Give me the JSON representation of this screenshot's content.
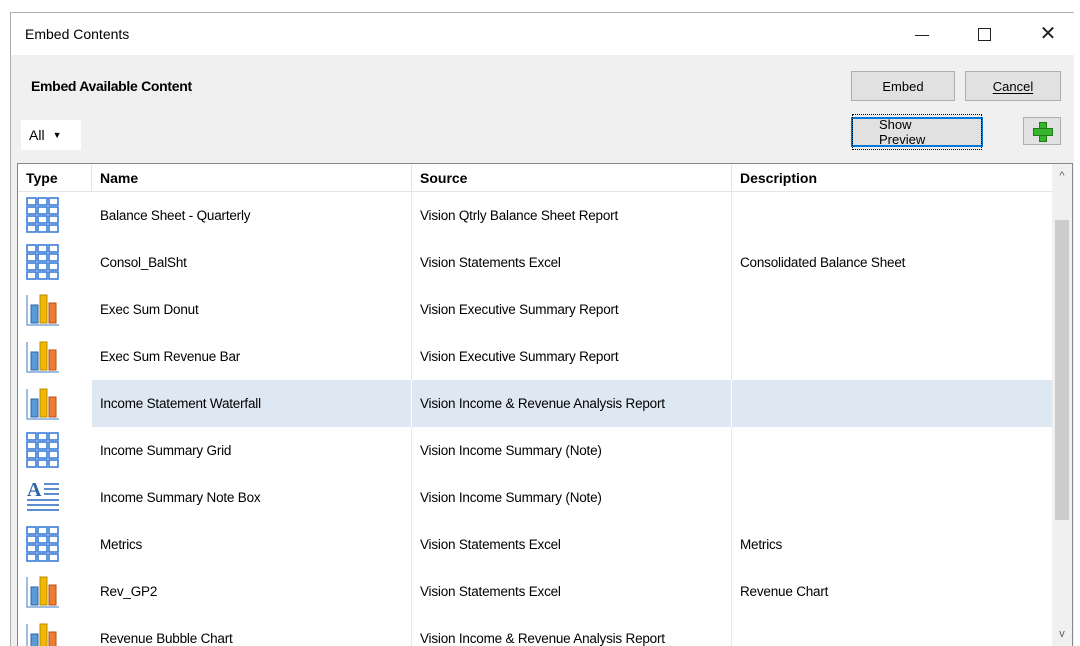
{
  "window": {
    "title": "Embed Contents"
  },
  "header": {
    "title": "Embed Available Content"
  },
  "buttons": {
    "embed": "Embed",
    "cancel": "Cancel",
    "show_preview": "Show Preview"
  },
  "filter": {
    "selected": "All",
    "caret": "▼"
  },
  "icons": {
    "close": "✕",
    "scroll_up": "^",
    "scroll_down": "v"
  },
  "columns": {
    "type": "Type",
    "name": "Name",
    "source": "Source",
    "description": "Description"
  },
  "rows": [
    {
      "icon": "grid",
      "name": "Balance Sheet - Quarterly",
      "source": "Vision Qtrly Balance Sheet Report",
      "description": ""
    },
    {
      "icon": "grid",
      "name": "Consol_BalSht",
      "source": "Vision Statements Excel",
      "description": "Consolidated Balance Sheet"
    },
    {
      "icon": "chart",
      "name": "Exec Sum Donut",
      "source": "Vision Executive Summary Report",
      "description": ""
    },
    {
      "icon": "chart",
      "name": "Exec Sum Revenue Bar",
      "source": "Vision Executive Summary Report",
      "description": ""
    },
    {
      "icon": "chart",
      "name": "Income Statement Waterfall",
      "source": "Vision Income & Revenue Analysis Report",
      "description": "",
      "selected": true
    },
    {
      "icon": "grid",
      "name": "Income Summary Grid",
      "source": "Vision Income Summary (Note)",
      "description": ""
    },
    {
      "icon": "text",
      "name": "Income Summary Note Box",
      "source": "Vision Income Summary (Note)",
      "description": ""
    },
    {
      "icon": "grid",
      "name": "Metrics",
      "source": "Vision Statements Excel",
      "description": "Metrics"
    },
    {
      "icon": "chart",
      "name": "Rev_GP2",
      "source": "Vision Statements Excel",
      "description": "Revenue Chart"
    },
    {
      "icon": "chart",
      "name": "Revenue Bubble Chart",
      "source": "Vision Income & Revenue Analysis Report",
      "description": ""
    }
  ],
  "colors": {
    "selected_row": "#dde8f3",
    "grid_icon": "#3b7dd8",
    "bar_blue": "#5b9bd5",
    "bar_yellow": "#f2b800",
    "bar_orange": "#ed7d31"
  }
}
